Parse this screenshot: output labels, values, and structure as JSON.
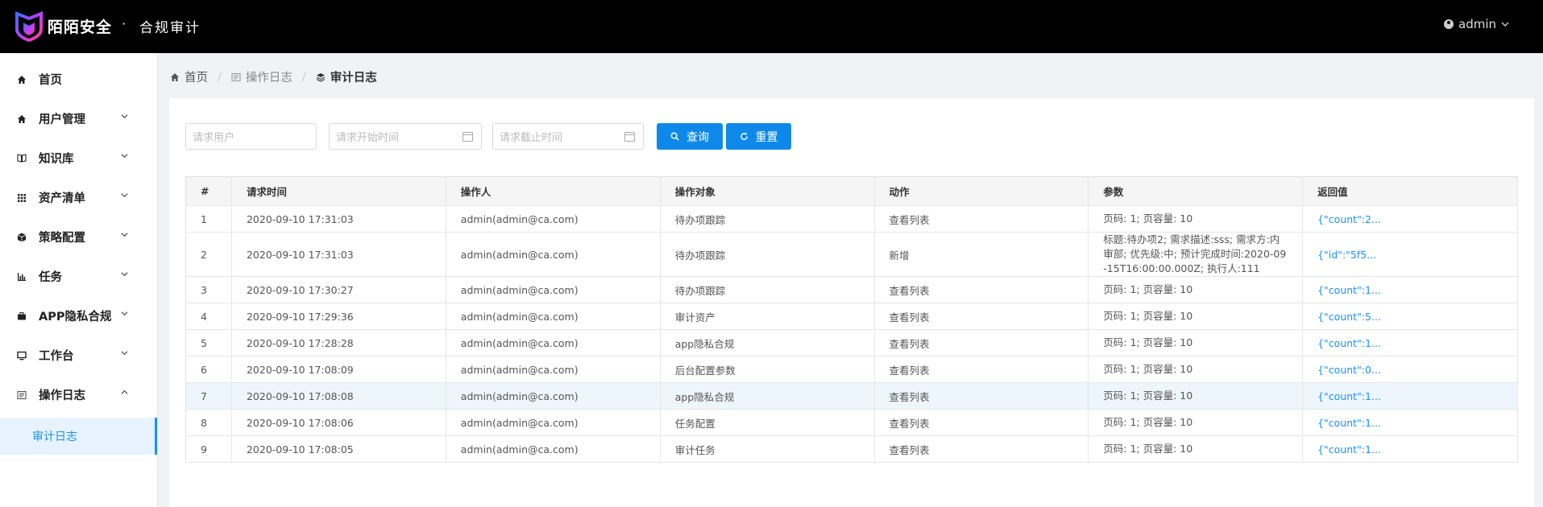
{
  "header": {
    "brand": "陌陌安全",
    "dot": "·",
    "subtitle": "合规审计",
    "user": "admin"
  },
  "sidebar": {
    "items": [
      {
        "label": "首页",
        "icon": "home-icon",
        "expandable": false
      },
      {
        "label": "用户管理",
        "icon": "home-icon",
        "expandable": true
      },
      {
        "label": "知识库",
        "icon": "book-icon",
        "expandable": true
      },
      {
        "label": "资产清单",
        "icon": "grid-icon",
        "expandable": true
      },
      {
        "label": "策略配置",
        "icon": "cube-icon",
        "expandable": true
      },
      {
        "label": "任务",
        "icon": "bar-chart-icon",
        "expandable": true
      },
      {
        "label": "APP隐私合规",
        "icon": "briefcase-icon",
        "expandable": true
      },
      {
        "label": "工作台",
        "icon": "desktop-icon",
        "expandable": true
      },
      {
        "label": "操作日志",
        "icon": "log-icon",
        "expandable": true,
        "expanded": true
      }
    ],
    "sub_item": "审计日志"
  },
  "breadcrumb": {
    "home": "首页",
    "parent": "操作日志",
    "current": "审计日志"
  },
  "filters": {
    "user_placeholder": "请求用户",
    "start_placeholder": "请求开始时间",
    "end_placeholder": "请求截止时间",
    "search_label": "查询",
    "reset_label": "重置"
  },
  "table": {
    "columns": [
      "#",
      "请求时间",
      "操作人",
      "操作对象",
      "动作",
      "参数",
      "返回值"
    ],
    "rows": [
      {
        "idx": "1",
        "time": "2020-09-10 17:31:03",
        "user": "admin(admin@ca.com)",
        "target": "待办项跟踪",
        "action": "查看列表",
        "params": "页码: 1; 页容量: 10",
        "ret": "{\"count\":2..."
      },
      {
        "idx": "2",
        "time": "2020-09-10 17:31:03",
        "user": "admin(admin@ca.com)",
        "target": "待办项跟踪",
        "action": "新增",
        "params": "标题:待办项2; 需求描述:sss; 需求方:内审部; 优先级:中; 预计完成时间:2020-09-15T16:00:00.000Z; 执行人:111",
        "ret": "{\"id\":\"5f5..."
      },
      {
        "idx": "3",
        "time": "2020-09-10 17:30:27",
        "user": "admin(admin@ca.com)",
        "target": "待办项跟踪",
        "action": "查看列表",
        "params": "页码: 1; 页容量: 10",
        "ret": "{\"count\":1..."
      },
      {
        "idx": "4",
        "time": "2020-09-10 17:29:36",
        "user": "admin(admin@ca.com)",
        "target": "审计资产",
        "action": "查看列表",
        "params": "页码: 1; 页容量: 10",
        "ret": "{\"count\":5..."
      },
      {
        "idx": "5",
        "time": "2020-09-10 17:28:28",
        "user": "admin(admin@ca.com)",
        "target": "app隐私合规",
        "action": "查看列表",
        "params": "页码: 1; 页容量: 10",
        "ret": "{\"count\":1..."
      },
      {
        "idx": "6",
        "time": "2020-09-10 17:08:09",
        "user": "admin(admin@ca.com)",
        "target": "后台配置参数",
        "action": "查看列表",
        "params": "页码: 1; 页容量: 10",
        "ret": "{\"count\":0..."
      },
      {
        "idx": "7",
        "time": "2020-09-10 17:08:08",
        "user": "admin(admin@ca.com)",
        "target": "app隐私合规",
        "action": "查看列表",
        "params": "页码: 1; 页容量: 10",
        "ret": "{\"count\":1...",
        "highlight": true
      },
      {
        "idx": "8",
        "time": "2020-09-10 17:08:06",
        "user": "admin(admin@ca.com)",
        "target": "任务配置",
        "action": "查看列表",
        "params": "页码: 1; 页容量: 10",
        "ret": "{\"count\":1..."
      },
      {
        "idx": "9",
        "time": "2020-09-10 17:08:05",
        "user": "admin(admin@ca.com)",
        "target": "审计任务",
        "action": "查看列表",
        "params": "页码: 1; 页容量: 10",
        "ret": "{\"count\":1..."
      }
    ]
  },
  "colors": {
    "accent": "#0e89e9",
    "link": "#1890ff",
    "header_bg": "#000000",
    "highlight_row": "#eef6fd"
  }
}
